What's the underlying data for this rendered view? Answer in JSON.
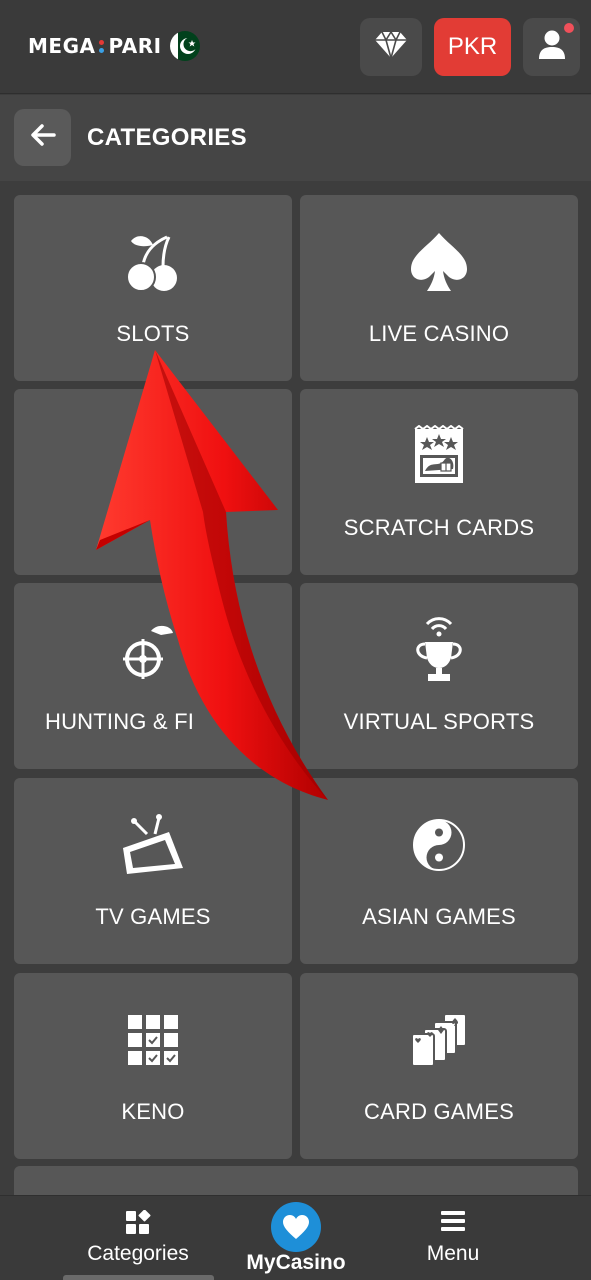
{
  "header": {
    "logo_left": "MEGA",
    "logo_right": "PARI",
    "currency_label": "PKR",
    "colors": {
      "accent_red": "#e23c35",
      "brand_blue": "#3aa0e6"
    }
  },
  "titlebar": {
    "title": "CATEGORIES"
  },
  "categories": [
    {
      "label": "SLOTS",
      "icon": "cherries-icon"
    },
    {
      "label": "LIVE CASINO",
      "icon": "spade-icon"
    },
    {
      "label": "",
      "icon": "hidden-icon"
    },
    {
      "label": "SCRATCH CARDS",
      "icon": "scratch-card-icon"
    },
    {
      "label": "HUNTING & FI",
      "icon": "hunting-fishing-icon"
    },
    {
      "label": "VIRTUAL SPORTS",
      "icon": "trophy-icon"
    },
    {
      "label": "TV GAMES",
      "icon": "tv-icon"
    },
    {
      "label": "ASIAN GAMES",
      "icon": "yin-yang-icon"
    },
    {
      "label": "KENO",
      "icon": "keno-grid-icon"
    },
    {
      "label": "CARD GAMES",
      "icon": "cards-icon"
    }
  ],
  "bottom_nav": {
    "categories_label": "Categories",
    "mycasino_label": "MyCasino",
    "menu_label": "Menu",
    "colors": {
      "mycasino_circle": "#1e8fd8"
    }
  }
}
